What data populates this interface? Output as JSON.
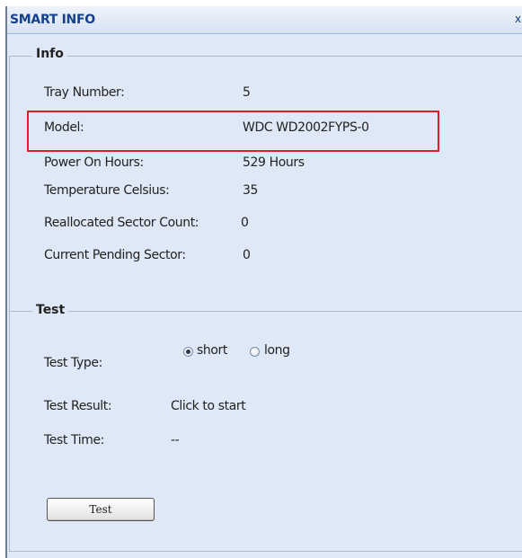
{
  "window": {
    "title": "SMART INFO",
    "close_label": "x"
  },
  "info": {
    "legend": "Info",
    "rows": [
      {
        "label": "Tray Number:",
        "value": "5"
      },
      {
        "label": "Model:",
        "value": "WDC WD2002FYPS-0"
      },
      {
        "label": "Power On Hours:",
        "value": "529 Hours"
      },
      {
        "label": "Temperature Celsius:",
        "value": "35"
      },
      {
        "label": "Reallocated Sector Count:",
        "value": "0"
      },
      {
        "label": "Current Pending Sector:",
        "value": "0"
      }
    ]
  },
  "test": {
    "legend": "Test",
    "type_label": "Test Type:",
    "options": [
      {
        "label": "short",
        "checked": true
      },
      {
        "label": "long",
        "checked": false
      }
    ],
    "result_label": "Test Result:",
    "result_value": "Click to start",
    "time_label": "Test Time:",
    "time_value": "--",
    "button_label": "Test"
  },
  "colors": {
    "panel_background": "#dfe8f6",
    "title_text": "#15428b",
    "highlight_border": "#e02020"
  }
}
